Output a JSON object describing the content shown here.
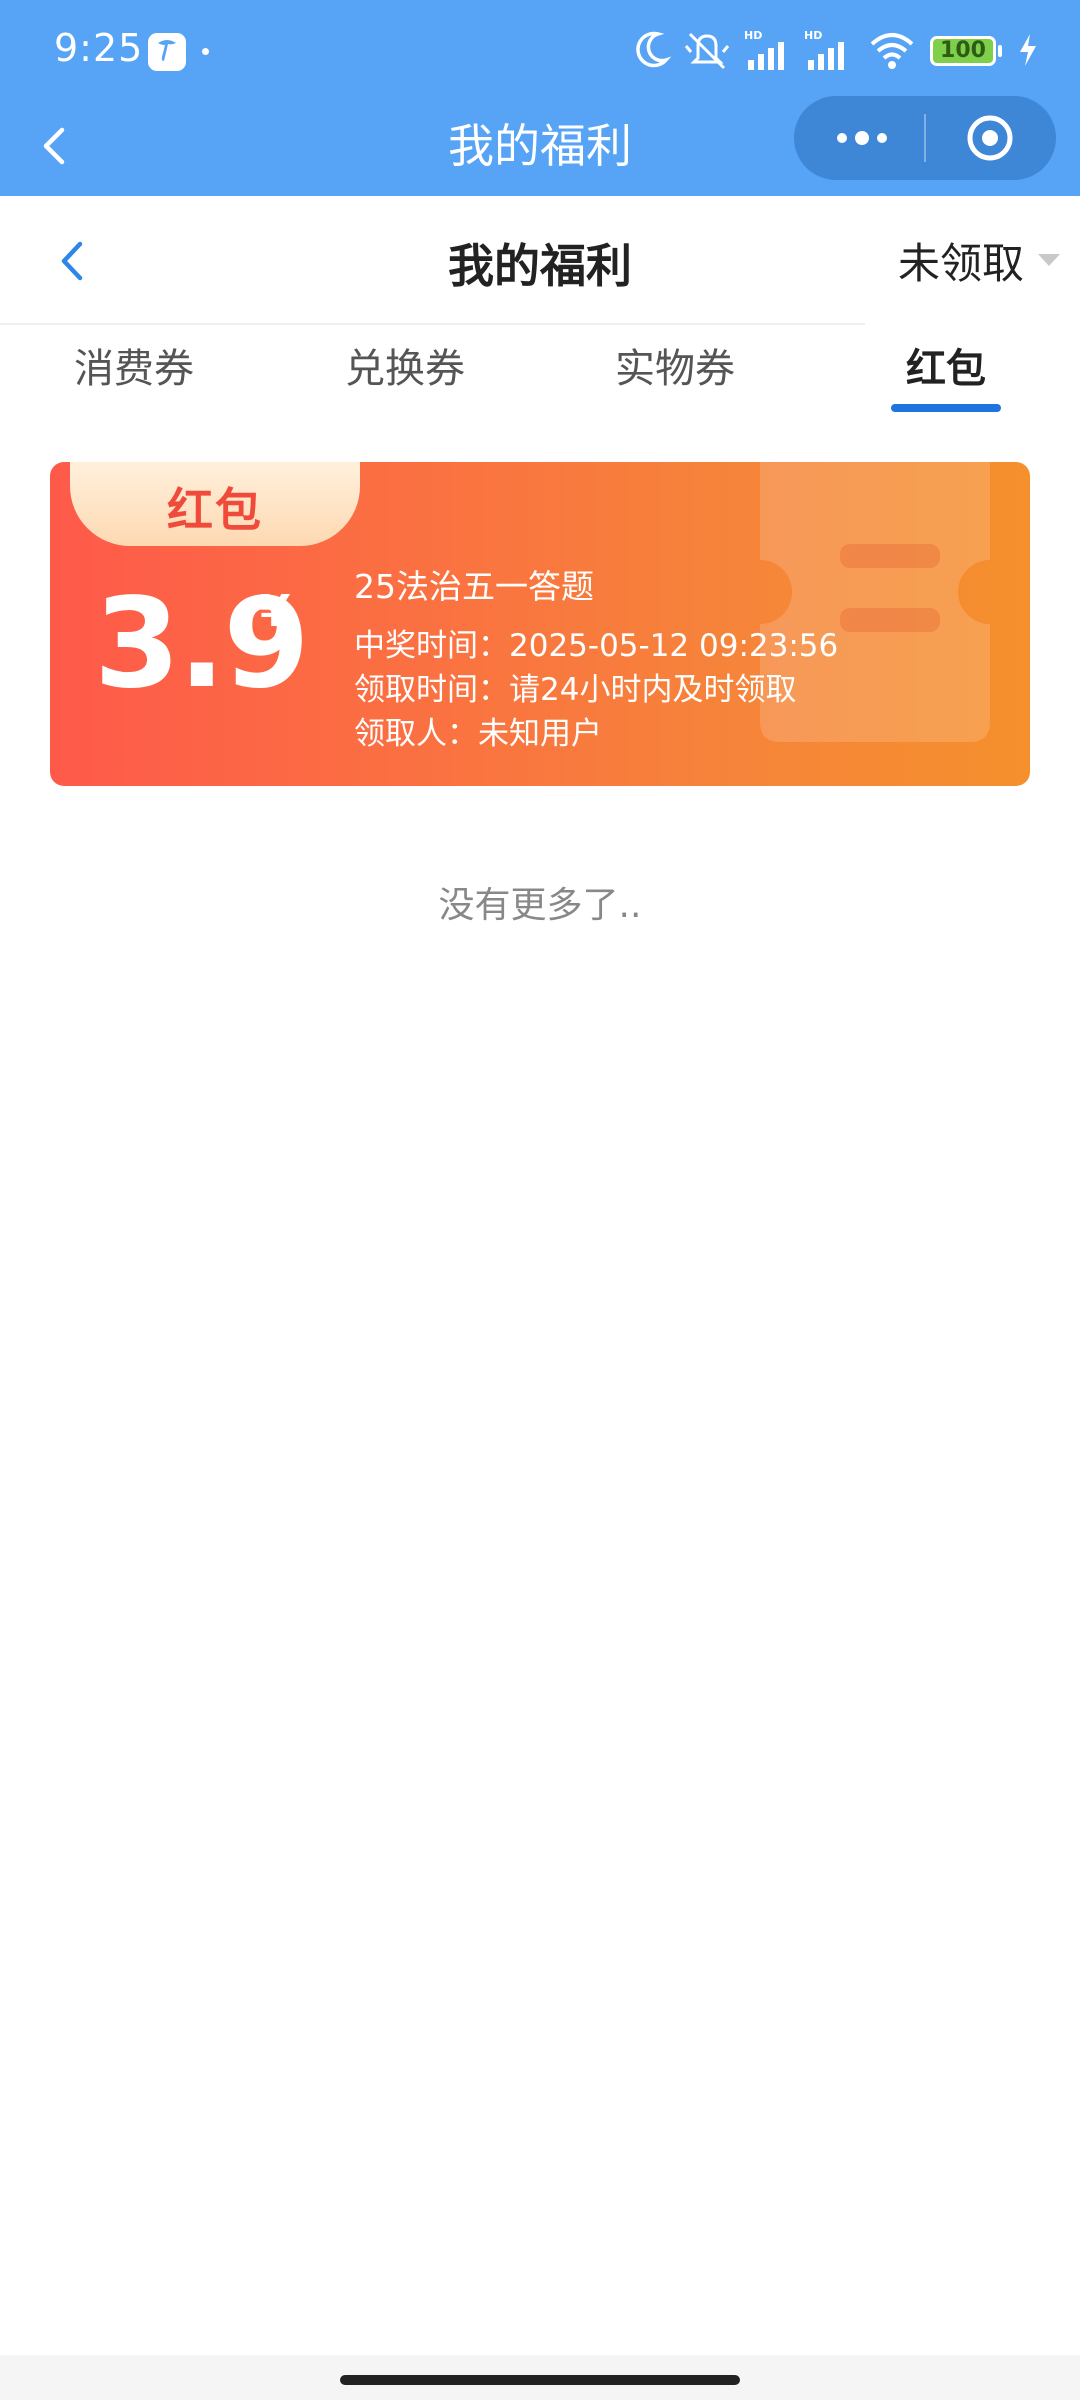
{
  "status_bar": {
    "time": "9:25",
    "battery": "100",
    "icons": [
      "carrier-icon",
      "moon-icon",
      "mute-icon",
      "signal-hd-icon",
      "signal-hd-icon",
      "wifi-icon",
      "battery-icon",
      "charging-icon"
    ]
  },
  "mini_program_header": {
    "title": "我的福利",
    "icons": [
      "back-icon",
      "more-icon",
      "close-target-icon"
    ]
  },
  "page_header": {
    "title": "我的福利",
    "filter_label": "未领取"
  },
  "tabs": [
    {
      "label": "消费券",
      "active": false
    },
    {
      "label": "兑换券",
      "active": false
    },
    {
      "label": "实物券",
      "active": false
    },
    {
      "label": "红包",
      "active": true
    }
  ],
  "card": {
    "tag": "红包",
    "amount": "3.9",
    "currency": "¥",
    "name": "25法治五一答题",
    "win_time": "中奖时间：2025-05-12 09:23:56",
    "claim_time": "领取时间：请24小时内及时领取",
    "claimer": "领取人：未知用户"
  },
  "footer_note": "没有更多了..",
  "colors": {
    "header_blue": "#57a4f6",
    "capsule_blue": "#3e86d6",
    "tab_active_underline": "#1f74e0",
    "card_gradient_start": "#fe5a4a",
    "card_gradient_end": "#f5902d"
  }
}
